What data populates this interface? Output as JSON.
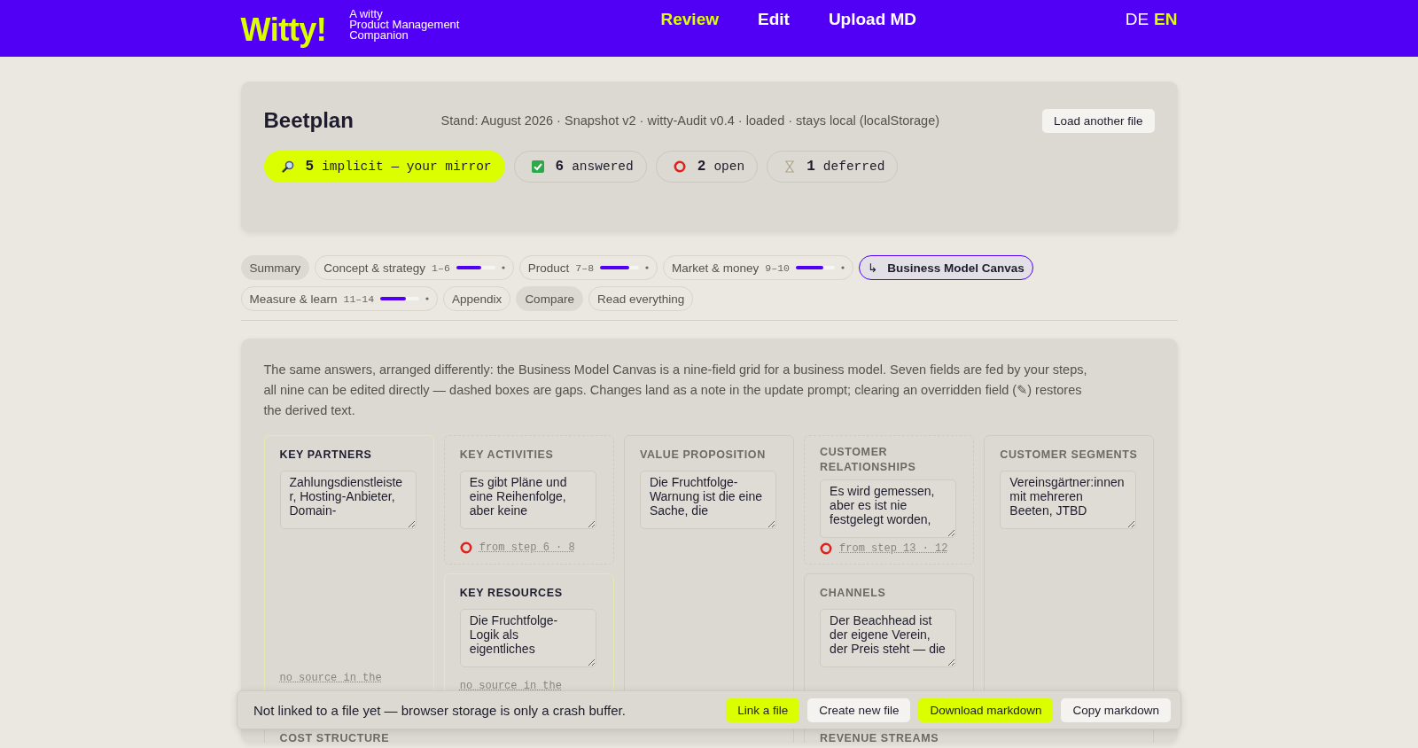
{
  "header": {
    "logo": "Witty!",
    "tagline": [
      "A witty",
      "Product Management",
      "Companion"
    ],
    "nav": [
      {
        "label": "Review",
        "selected": true
      },
      {
        "label": "Edit",
        "selected": false
      },
      {
        "label": "Upload MD",
        "selected": false
      }
    ],
    "languages": [
      {
        "label": "DE",
        "selected": false
      },
      {
        "label": "EN",
        "selected": true
      }
    ]
  },
  "project": {
    "title": "Beetplan",
    "meta": "Stand: August 2026 · Snapshot v2 · witty-Audit v0.4 · loaded · stays local (localStorage)",
    "load_button": "Load another file",
    "counters": [
      {
        "kind": "implicit",
        "count": "5",
        "label": "implicit — your mirror",
        "selected": true
      },
      {
        "kind": "answered",
        "count": "6",
        "label": "answered",
        "selected": false
      },
      {
        "kind": "open",
        "count": "2",
        "label": "open",
        "selected": false
      },
      {
        "kind": "deferred",
        "count": "1",
        "label": "deferred",
        "selected": false
      }
    ]
  },
  "tabs": [
    {
      "kind": "filled",
      "label": "Summary",
      "selected": false
    },
    {
      "kind": "section",
      "label": "Concept & strategy",
      "range": "1–6",
      "level": 0.65,
      "selected": false
    },
    {
      "kind": "section",
      "label": "Product",
      "range": "7–8",
      "level": 0.75,
      "selected": false
    },
    {
      "kind": "section",
      "label": "Market & money",
      "range": "9–10",
      "level": 0.7,
      "selected": false
    },
    {
      "kind": "view",
      "icon": "↳",
      "label": "Business Model Canvas",
      "selected": true
    },
    {
      "kind": "section",
      "label": "Measure & learn",
      "range": "11–14",
      "level": 0.65,
      "selected": false
    },
    {
      "kind": "outlined",
      "label": "Appendix",
      "selected": false
    },
    {
      "kind": "filled",
      "label": "Compare",
      "selected": false
    },
    {
      "kind": "outlined",
      "label": "Read everything",
      "selected": false
    }
  ],
  "canvas": {
    "intro": "The same answers, arranged differently: the Business Model Canvas is a nine-field grid for a business model. Seven fields are fed by your steps, all nine can be edited directly — dashed boxes are gaps. Changes land as a note in the update prompt; clearing an overridden field (✎) restores the derived text.",
    "fields": [
      {
        "kind": "overridden",
        "title": "KEY PARTNERS",
        "text": "Zahlungsdienstleister, Hosting-Anbieter, Domain-",
        "source": {
          "kind": "none",
          "text": "no source in the"
        }
      },
      {
        "kind": "gap",
        "title": "KEY ACTIVITIES",
        "text": "Es gibt Pläne und eine Reihenfolge, aber keine",
        "source": {
          "kind": "open",
          "text": "from step 6 · 8"
        }
      },
      {
        "kind": "overridden",
        "title": "KEY RESOURCES",
        "text": "Die Fruchtfolge-Logik als eigentliches",
        "source": {
          "kind": "none",
          "text": "no source in the"
        }
      },
      {
        "kind": "derived",
        "title": "VALUE PROPOSITION",
        "text": "Die Fruchtfolge-Warnung ist die eine Sache, die"
      },
      {
        "kind": "gap",
        "title": "CUSTOMER RELATIONSHIPS",
        "text": "Es wird gemessen, aber es ist nie festgelegt worden,",
        "source": {
          "kind": "open",
          "text": "from step 13 · 12"
        }
      },
      {
        "kind": "derived",
        "title": "CHANNELS",
        "text": "Der Beachhead ist der eigene Verein, der Preis steht — die"
      },
      {
        "kind": "derived",
        "title": "CUSTOMER SEGMENTS",
        "text": "Vereinsgärtner:innen mit mehreren Beeten, JTBD"
      },
      {
        "kind": "derived",
        "title": "COST STRUCTURE"
      },
      {
        "kind": "derived",
        "title": "REVENUE STREAMS"
      }
    ]
  },
  "file_bar": {
    "message": "Not linked to a file yet — browser storage is only a crash buffer.",
    "buttons": [
      {
        "label": "Link a file",
        "kind": "primary"
      },
      {
        "label": "Create new file",
        "kind": "secondary"
      },
      {
        "label": "Download markdown",
        "kind": "primary"
      },
      {
        "label": "Copy markdown",
        "kind": "secondary"
      }
    ]
  }
}
